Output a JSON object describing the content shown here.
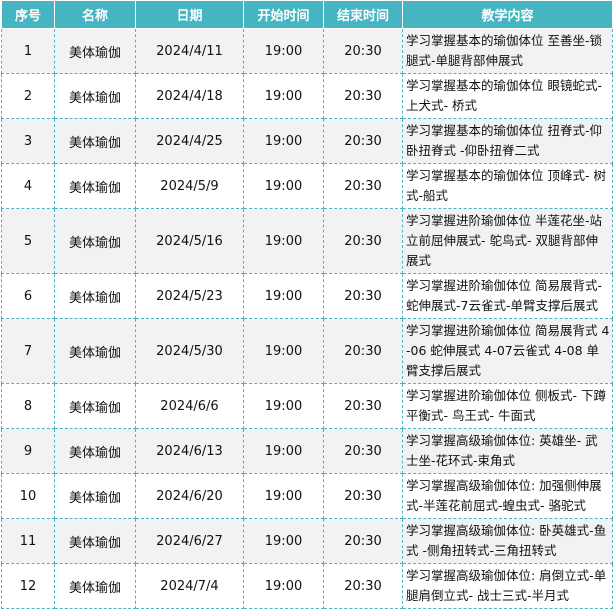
{
  "headers": [
    "序号",
    "名称",
    "日期",
    "开始时间",
    "结束时间",
    "教学内容"
  ],
  "rows": [
    {
      "no": "1",
      "name": "美体瑜伽",
      "date": "2024/4/11",
      "start": "19:00",
      "end": "20:30",
      "content": "学习掌握基本的瑜伽体位 至善坐-锁腿式-单腿背部伸展式"
    },
    {
      "no": "2",
      "name": "美体瑜伽",
      "date": "2024/4/18",
      "start": "19:00",
      "end": "20:30",
      "content": "学习掌握基本的瑜伽体位 眼镜蛇式-上犬式- 桥式"
    },
    {
      "no": "3",
      "name": "美体瑜伽",
      "date": "2024/4/25",
      "start": "19:00",
      "end": "20:30",
      "content": "学习掌握基本的瑜伽体位 扭脊式-仰卧扭脊式 -仰卧扭脊二式"
    },
    {
      "no": "4",
      "name": "美体瑜伽",
      "date": "2024/5/9",
      "start": "19:00",
      "end": "20:30",
      "content": "学习掌握基本的瑜伽体位 顶峰式- 树式-船式"
    },
    {
      "no": "5",
      "name": "美体瑜伽",
      "date": "2024/5/16",
      "start": "19:00",
      "end": "20:30",
      "content": "学习掌握进阶瑜伽体位 半莲花坐-站立前屈伸展式- 鸵鸟式- 双腿背部伸展式"
    },
    {
      "no": "6",
      "name": "美体瑜伽",
      "date": "2024/5/23",
      "start": "19:00",
      "end": "20:30",
      "content": "学习掌握进阶瑜伽体位 简易展背式-蛇伸展式-7云雀式-单臂支撑后展式"
    },
    {
      "no": "7",
      "name": "美体瑜伽",
      "date": "2024/5/30",
      "start": "19:00",
      "end": "20:30",
      "content": "学习掌握进阶瑜伽体位 简易展背式 4-06 蛇伸展式 4-07云雀式 4-08 单臂支撑后展式"
    },
    {
      "no": "8",
      "name": "美体瑜伽",
      "date": "2024/6/6",
      "start": "19:00",
      "end": "20:30",
      "content": "学习掌握进阶瑜伽体位 侧板式- 下蹲平衡式- 鸟王式- 牛面式"
    },
    {
      "no": "9",
      "name": "美体瑜伽",
      "date": "2024/6/13",
      "start": "19:00",
      "end": "20:30",
      "content": "学习掌握高级瑜伽体位:  英雄坐- 武士坐-花环式-束角式"
    },
    {
      "no": "10",
      "name": "美体瑜伽",
      "date": "2024/6/20",
      "start": "19:00",
      "end": "20:30",
      "content": "学习掌握高级瑜伽体位:  加强侧伸展式-半莲花前屈式-蝗虫式- 骆驼式"
    },
    {
      "no": "11",
      "name": "美体瑜伽",
      "date": "2024/6/27",
      "start": "19:00",
      "end": "20:30",
      "content": "学习掌握高级瑜伽体位:  卧英雄式-鱼式 -侧角扭转式-三角扭转式"
    },
    {
      "no": "12",
      "name": "美体瑜伽",
      "date": "2024/7/4",
      "start": "19:00",
      "end": "20:30",
      "content": "学习掌握高级瑜伽体位:  肩倒立式-单腿肩倒立式- 战士三式-半月式"
    }
  ]
}
